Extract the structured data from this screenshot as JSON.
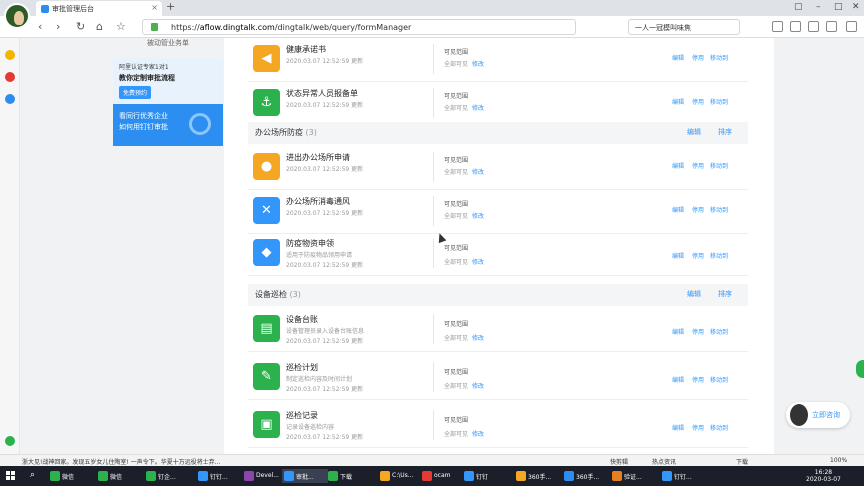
{
  "browser": {
    "tab_title": "审批管理后台",
    "url_prefix": "https://",
    "url_host": "aflow.dingtalk.com",
    "url_path": "/dingtalk/web/query/formManager",
    "search_text": "一人一冠模叫味焦"
  },
  "sidebar": {
    "top_text": "被动管业务单",
    "promo1_line1": "阿里认证专家1对1",
    "promo1_line2": "教你定制审批流程",
    "promo1_button": "免费预约",
    "promo2_line1": "看同行优秀企业",
    "promo2_line2": "如何用钉钉审批"
  },
  "colors": {
    "orange": "#f5a623",
    "blue": "#3296fa",
    "green": "#2bb24c",
    "link": "#3296fa"
  },
  "labels": {
    "visible_title": "可见范围",
    "visible_all": "全部可见",
    "modify": "修改",
    "edit": "编辑",
    "disable": "停用",
    "move_to": "移动到",
    "sort": "排序",
    "updated_suffix": "2020.03.07 12:52:59 更新"
  },
  "forms_top": [
    {
      "name": "健康承诺书",
      "desc": "",
      "icon": "megaphone-icon",
      "color": "orange"
    },
    {
      "name": "状态异常人员报备单",
      "desc": "",
      "icon": "anchor-icon",
      "color": "green"
    }
  ],
  "group1": {
    "title": "办公场所防疫",
    "count": "(3)"
  },
  "forms_group1": [
    {
      "name": "进出办公场所申请",
      "desc": "",
      "icon": "person-icon",
      "color": "orange"
    },
    {
      "name": "办公场所消毒通风",
      "desc": "",
      "icon": "tools-icon",
      "color": "blue"
    },
    {
      "name": "防疫物资申领",
      "desc": "适用于防疫物品领用申请",
      "icon": "box-icon",
      "color": "blue"
    }
  ],
  "group2": {
    "title": "设备巡检",
    "count": "(3)"
  },
  "forms_group2": [
    {
      "name": "设备台账",
      "desc": "设备管理员录入设备台账信息",
      "icon": "ledger-icon",
      "color": "green"
    },
    {
      "name": "巡检计划",
      "desc": "制定巡检内容及时间计划",
      "icon": "pen-icon",
      "color": "green"
    },
    {
      "name": "巡检记录",
      "desc": "记录设备巡检内容",
      "icon": "record-icon",
      "color": "green"
    }
  ],
  "consult": {
    "label": "立即咨询"
  },
  "statusbar": {
    "news": "浙大见!战神回家。发现五岁女儿住陶室! 一声令下。华夏十万远役将士弃...",
    "items": [
      "快剪辑",
      "热点资讯",
      "下载",
      "100%"
    ]
  },
  "taskbar": {
    "items": [
      "微信",
      "微信",
      "钉企...",
      "钉钉...",
      "Devel...",
      "审批...",
      "下载",
      "C:\\Us...",
      "ocam",
      "钉钉",
      "360手...",
      "360手...",
      "验证...",
      "钉钉..."
    ],
    "time": "16:28",
    "date": "2020-03-07"
  }
}
